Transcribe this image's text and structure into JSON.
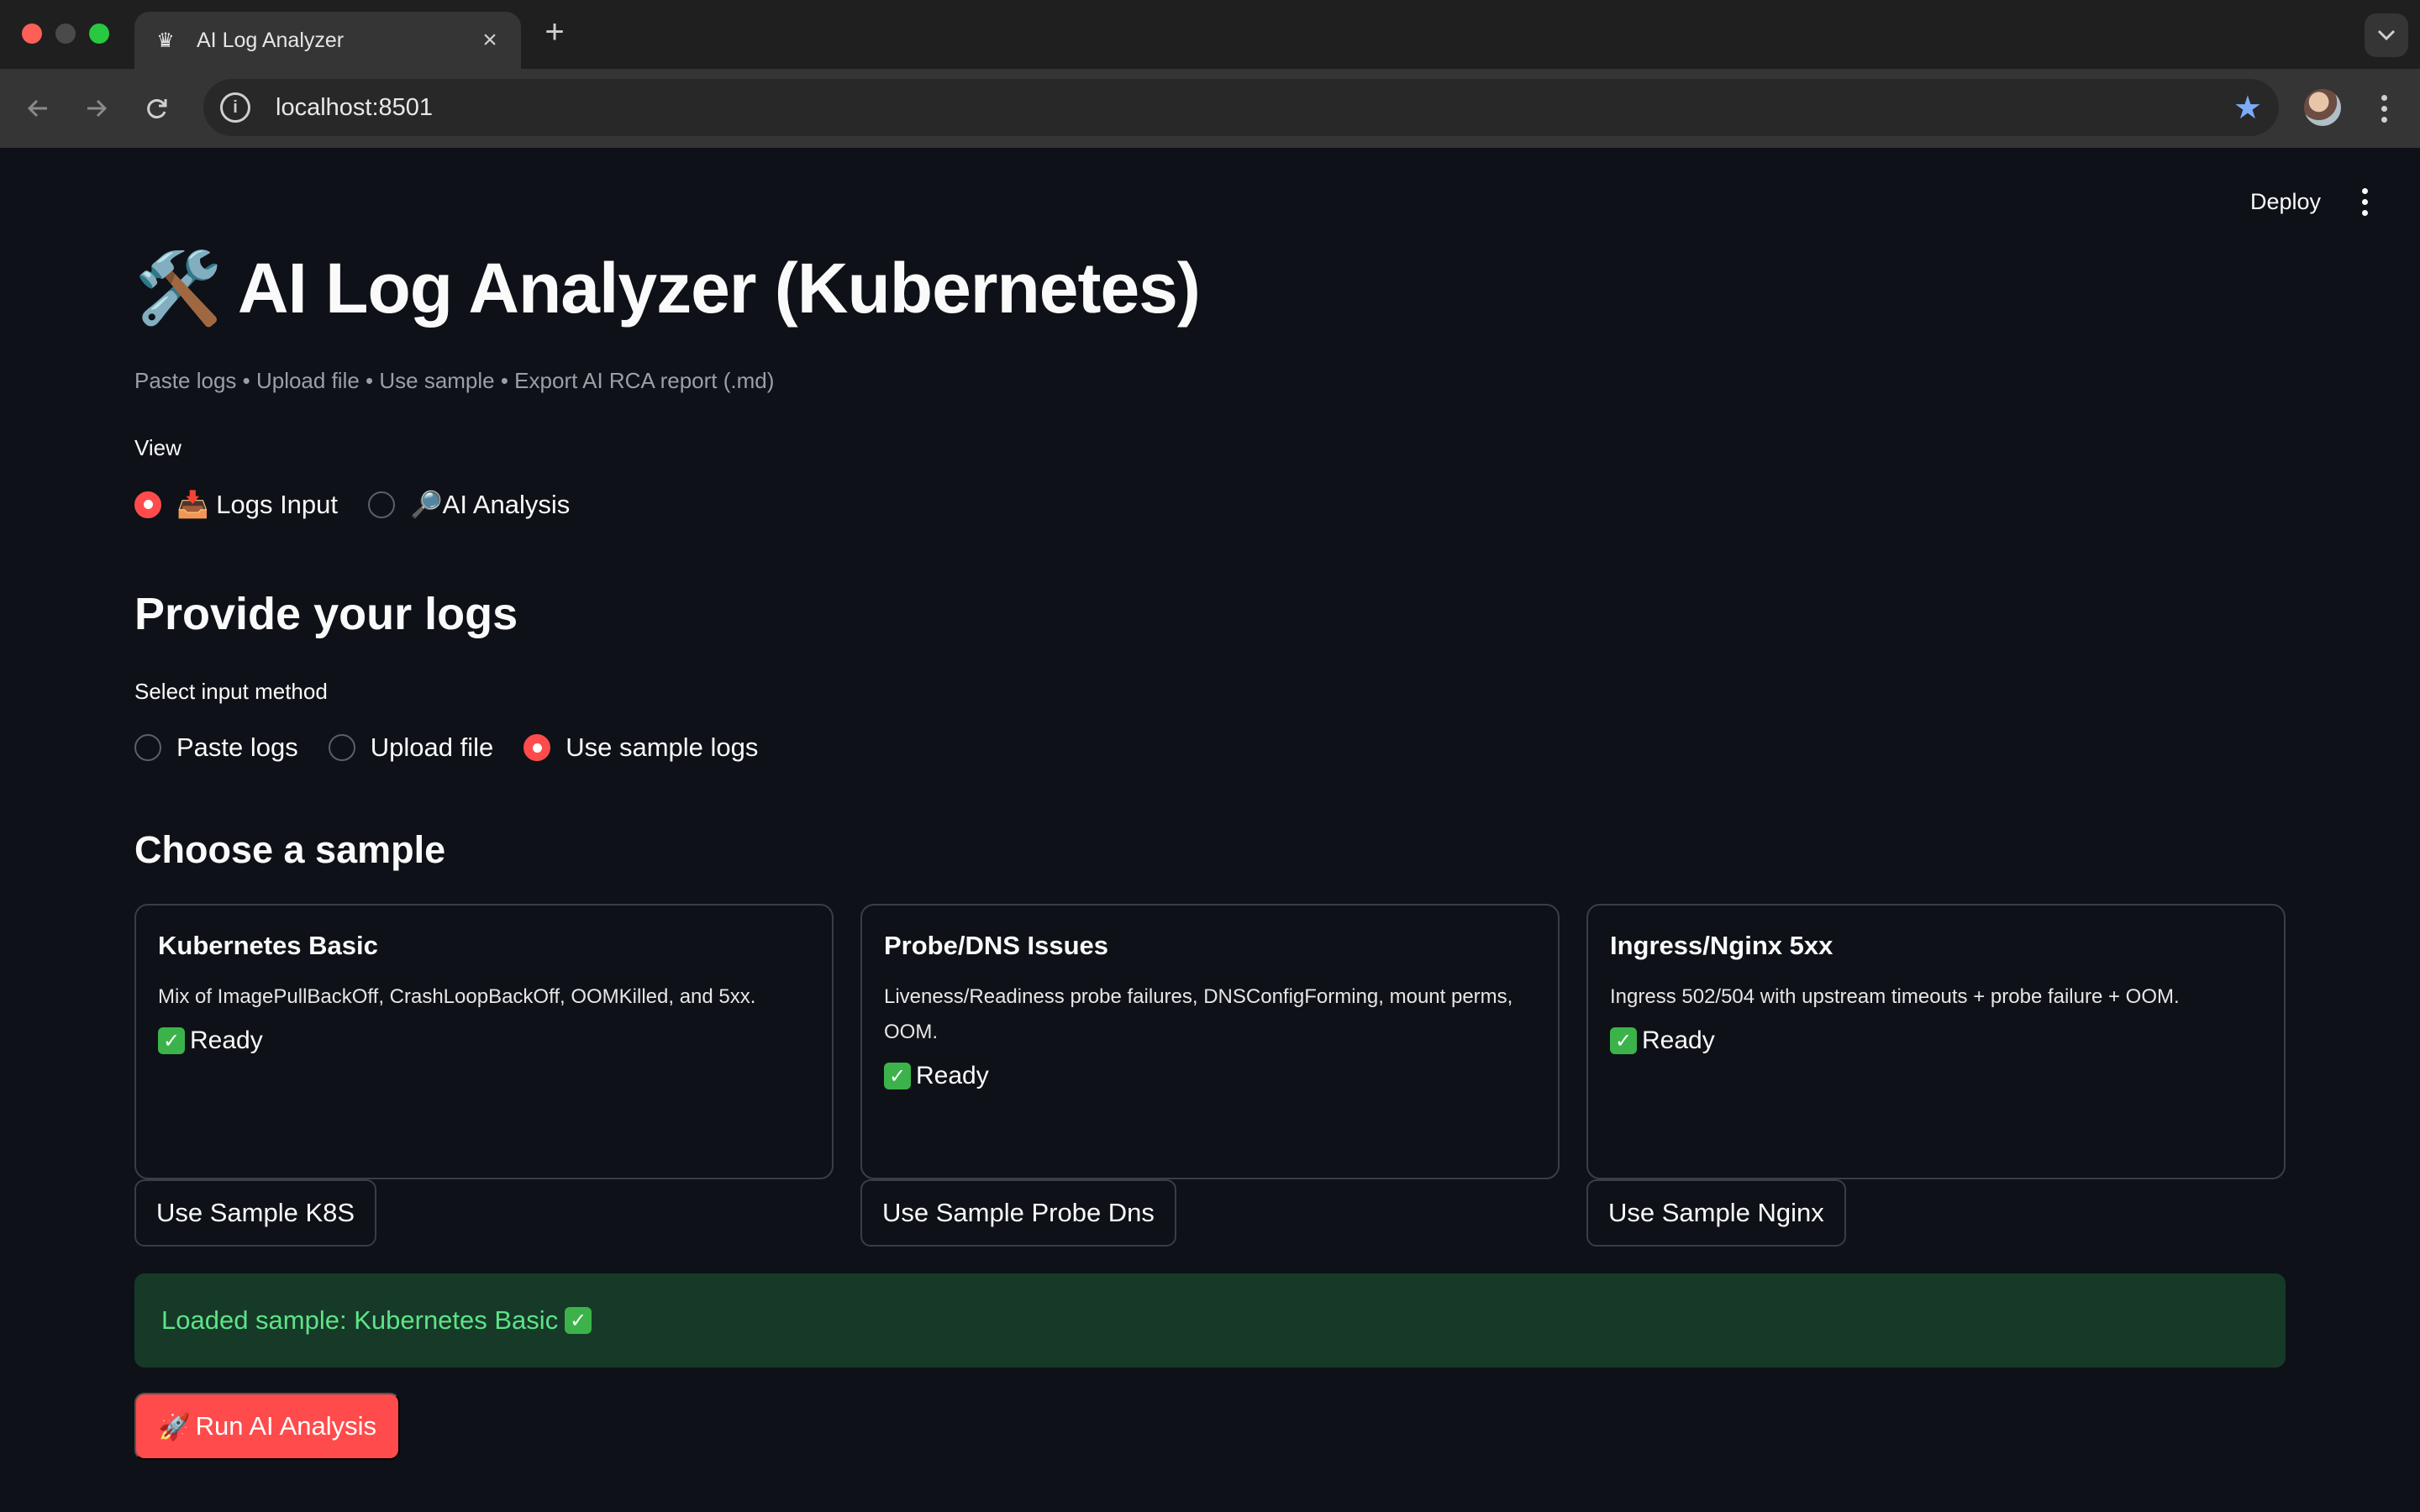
{
  "browser": {
    "tab_title": "AI Log Analyzer",
    "tab_close": "×",
    "new_tab": "+",
    "url": "localhost:8501",
    "favicon": "♛",
    "info_icon": "i",
    "star_icon": "★"
  },
  "app": {
    "deploy_label": "Deploy",
    "title_emoji": "🛠️",
    "title": "AI Log Analyzer (Kubernetes)",
    "subtitle": "Paste logs • Upload file • Use sample • Export AI RCA report (.md)",
    "view": {
      "label": "View",
      "options": [
        {
          "icon": "📥",
          "label": "Logs Input",
          "selected": true
        },
        {
          "icon": "🔎",
          "label": "AI Analysis",
          "selected": false
        }
      ]
    },
    "provide_heading": "Provide your logs",
    "input_method": {
      "label": "Select input method",
      "options": [
        {
          "label": "Paste logs",
          "selected": false
        },
        {
          "label": "Upload file",
          "selected": false
        },
        {
          "label": "Use sample logs",
          "selected": true
        }
      ]
    },
    "choose_heading": "Choose a sample",
    "samples": [
      {
        "title": "Kubernetes Basic",
        "description": "Mix of ImagePullBackOff, CrashLoopBackOff, OOMKilled, and 5xx.",
        "status": "Ready",
        "button": "Use Sample K8S"
      },
      {
        "title": "Probe/DNS Issues",
        "description": "Liveness/Readiness probe failures, DNSConfigForming, mount perms, OOM.",
        "status": "Ready",
        "button": "Use Sample Probe Dns"
      },
      {
        "title": "Ingress/Nginx 5xx",
        "description": "Ingress 502/504 with upstream timeouts + probe failure + OOM.",
        "status": "Ready",
        "button": "Use Sample Nginx"
      }
    ],
    "check_glyph": "✓",
    "alert_text": "Loaded sample: Kubernetes Basic",
    "run_button_icon": "🚀",
    "run_button": "Run AI Analysis"
  },
  "colors": {
    "background": "#0e1117",
    "accent": "#ff4b4b",
    "success_bg": "#173928",
    "success_text": "#5ce488"
  }
}
